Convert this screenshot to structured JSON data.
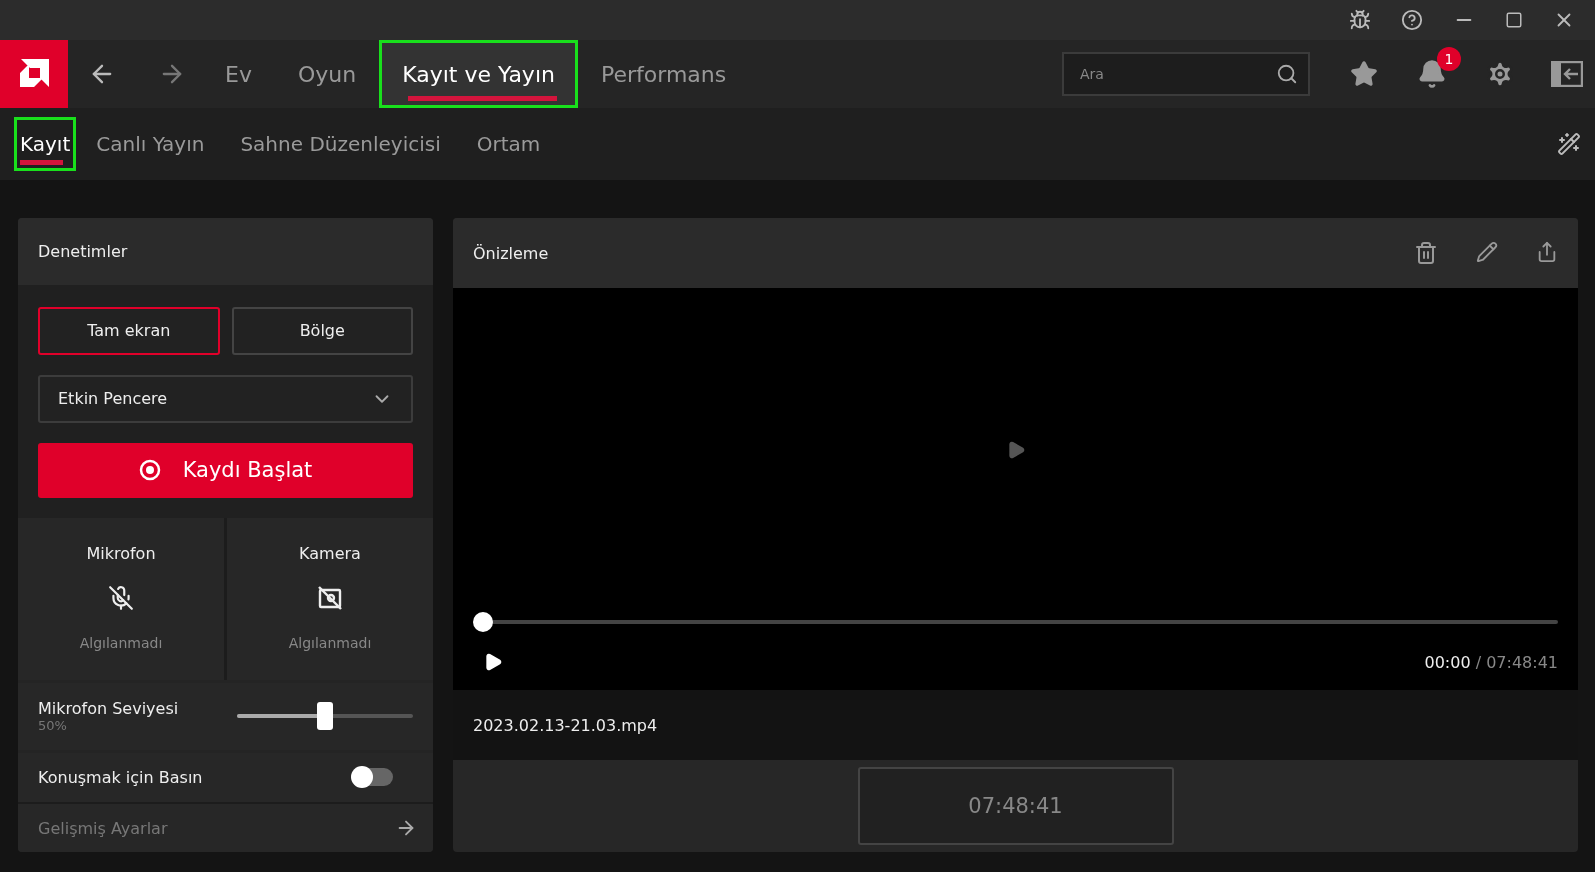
{
  "main_tabs": [
    {
      "label": "Ev",
      "selected": false,
      "highlighted": false
    },
    {
      "label": "Oyun",
      "selected": false,
      "highlighted": false
    },
    {
      "label": "Kayıt ve Yayın",
      "selected": true,
      "highlighted": true
    },
    {
      "label": "Performans",
      "selected": false,
      "highlighted": false
    }
  ],
  "search": {
    "placeholder": "Ara"
  },
  "notifications": {
    "badge": "1"
  },
  "sub_tabs": [
    {
      "label": "Kayıt",
      "selected": true,
      "highlighted": true
    },
    {
      "label": "Canlı Yayın",
      "selected": false,
      "highlighted": false
    },
    {
      "label": "Sahne Düzenleyicisi",
      "selected": false,
      "highlighted": false
    },
    {
      "label": "Ortam",
      "selected": false,
      "highlighted": false
    }
  ],
  "controls": {
    "title": "Denetimler",
    "modes": [
      {
        "label": "Tam ekran",
        "selected": true
      },
      {
        "label": "Bölge",
        "selected": false
      }
    ],
    "window_select": "Etkin Pencere",
    "record_button": "Kaydı Başlat",
    "devices": [
      {
        "kind": "mic",
        "name": "Mikrofon",
        "status": "Algılanmadı"
      },
      {
        "kind": "camera",
        "name": "Kamera",
        "status": "Algılanmadı"
      }
    ],
    "mic_level": {
      "label": "Mikrofon Seviyesi",
      "reading": "50%",
      "level": 0.5
    },
    "push_to_talk": {
      "label": "Konuşmak için Basın",
      "on": false
    },
    "advanced": "Gelişmiş Ayarlar"
  },
  "preview": {
    "title": "Önizleme",
    "progress": {
      "level": 0
    },
    "current_time": "00:00",
    "separator": "/",
    "total_time": "07:48:41",
    "file_name": "2023.02.13-21.03.mp4",
    "duration": "07:48:41"
  }
}
